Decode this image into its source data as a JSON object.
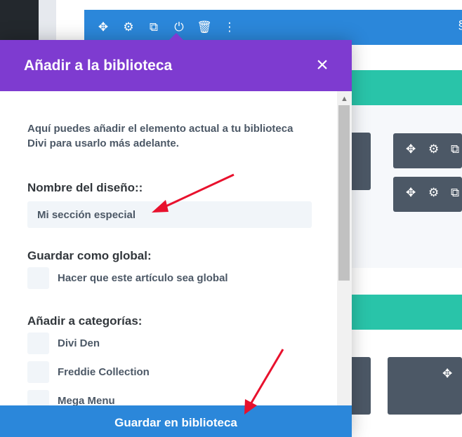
{
  "section_bar": {
    "icons": [
      "move-icon",
      "gear-icon",
      "duplicate-icon",
      "power-icon",
      "trash-icon",
      "more-icon"
    ]
  },
  "colors": {
    "modal_header": "#7e3bd0",
    "primary_blue": "#2b87da",
    "teal": "#29c4a9",
    "module_dark": "#4c5866",
    "arrow_red": "#e8112d"
  },
  "modal": {
    "title": "Añadir a la biblioteca",
    "description": "Aquí puedes añadir el elemento actual a tu biblioteca Divi para usarlo más adelante.",
    "name_label": "Nombre del diseño::",
    "name_value": "Mi sección especial",
    "global_label": "Guardar como global:",
    "global_option": "Hacer que este artículo sea global",
    "categories_label": "Añadir a categorías:",
    "categories": [
      "Divi Den",
      "Freddie Collection",
      "Mega Menu"
    ],
    "save_button": "Guardar en biblioteca"
  }
}
